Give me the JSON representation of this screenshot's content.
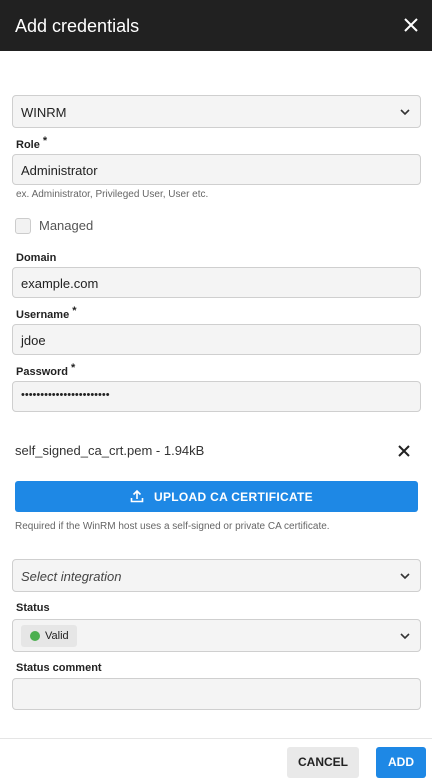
{
  "dialog": {
    "title": "Add credentials",
    "close_icon": "close-icon"
  },
  "protocol": {
    "selected": "WINRM"
  },
  "role": {
    "label": "Role",
    "required_mark": "*",
    "value": "Administrator",
    "hint": "ex. Administrator, Privileged User, User etc."
  },
  "managed": {
    "label": "Managed",
    "checked": false
  },
  "domain": {
    "label": "Domain",
    "value": "example.com"
  },
  "username": {
    "label": "Username",
    "required_mark": "*",
    "value": "jdoe"
  },
  "password": {
    "label": "Password",
    "required_mark": "*",
    "value": "•••••••••••••••••••••••"
  },
  "certificate": {
    "file_name": "self_signed_ca_crt.pem - 1.94kB",
    "upload_label": "UPLOAD CA CERTIFICATE",
    "upload_icon": "upload-icon",
    "hint": "Required if the WinRM host uses a self-signed or private CA certificate."
  },
  "integration": {
    "placeholder": "Select integration"
  },
  "status": {
    "label": "Status",
    "value": "Valid",
    "dot_color": "#4caf50"
  },
  "status_comment": {
    "label": "Status comment",
    "value": ""
  },
  "footer": {
    "cancel_label": "CANCEL",
    "add_label": "ADD"
  },
  "colors": {
    "header": "#212121",
    "accent": "#1e88e5"
  }
}
